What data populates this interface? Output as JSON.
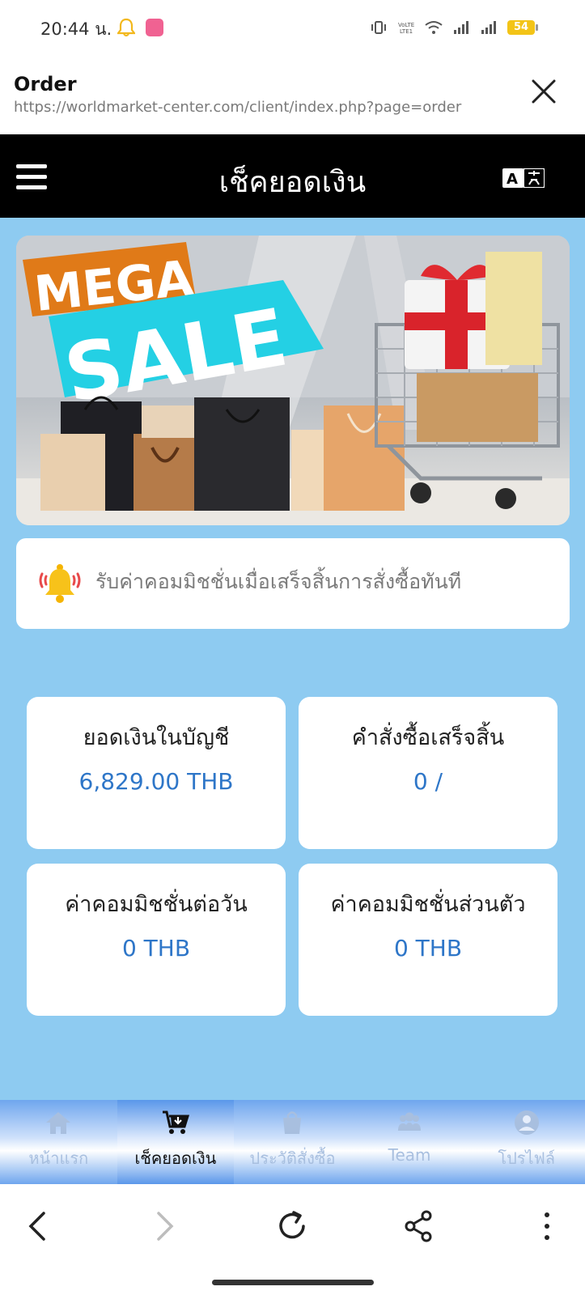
{
  "status_bar": {
    "time": "20:44 น.",
    "battery": "54"
  },
  "custom_tab": {
    "title": "Order",
    "url": "https://worldmarket-center.com/client/index.php?page=order"
  },
  "app_bar": {
    "title": "เช็คยอดเงิน"
  },
  "banner": {
    "line1": "MEGA",
    "line2": "SALE"
  },
  "notice": {
    "text": "รับค่าคอมมิชชั่นเมื่อเสร็จสิ้นการสั่งซื้อทันที"
  },
  "cards": [
    {
      "label": "ยอดเงินในบัญชี",
      "value": "6,829.00 THB"
    },
    {
      "label": "คำสั่งซื้อเสร็จสิ้น",
      "value": "0 /"
    },
    {
      "label": "ค่าคอมมิชชั่นต่อวัน",
      "value": "0 THB"
    },
    {
      "label": "ค่าคอมมิชชั่นส่วนตัว",
      "value": "0 THB"
    }
  ],
  "bottom_nav": [
    {
      "label": "หน้าแรก",
      "icon": "home-icon"
    },
    {
      "label": "เช็คยอดเงิน",
      "icon": "cart-icon",
      "active": true
    },
    {
      "label": "ประวัติสั่งซื้อ",
      "icon": "shopping-bag-icon"
    },
    {
      "label": "Team",
      "icon": "team-icon"
    },
    {
      "label": "โปรไฟล์",
      "icon": "profile-icon"
    }
  ],
  "colors": {
    "page_bg": "#8ecbf1",
    "value_text": "#2e76c8",
    "app_bar": "#000000"
  }
}
